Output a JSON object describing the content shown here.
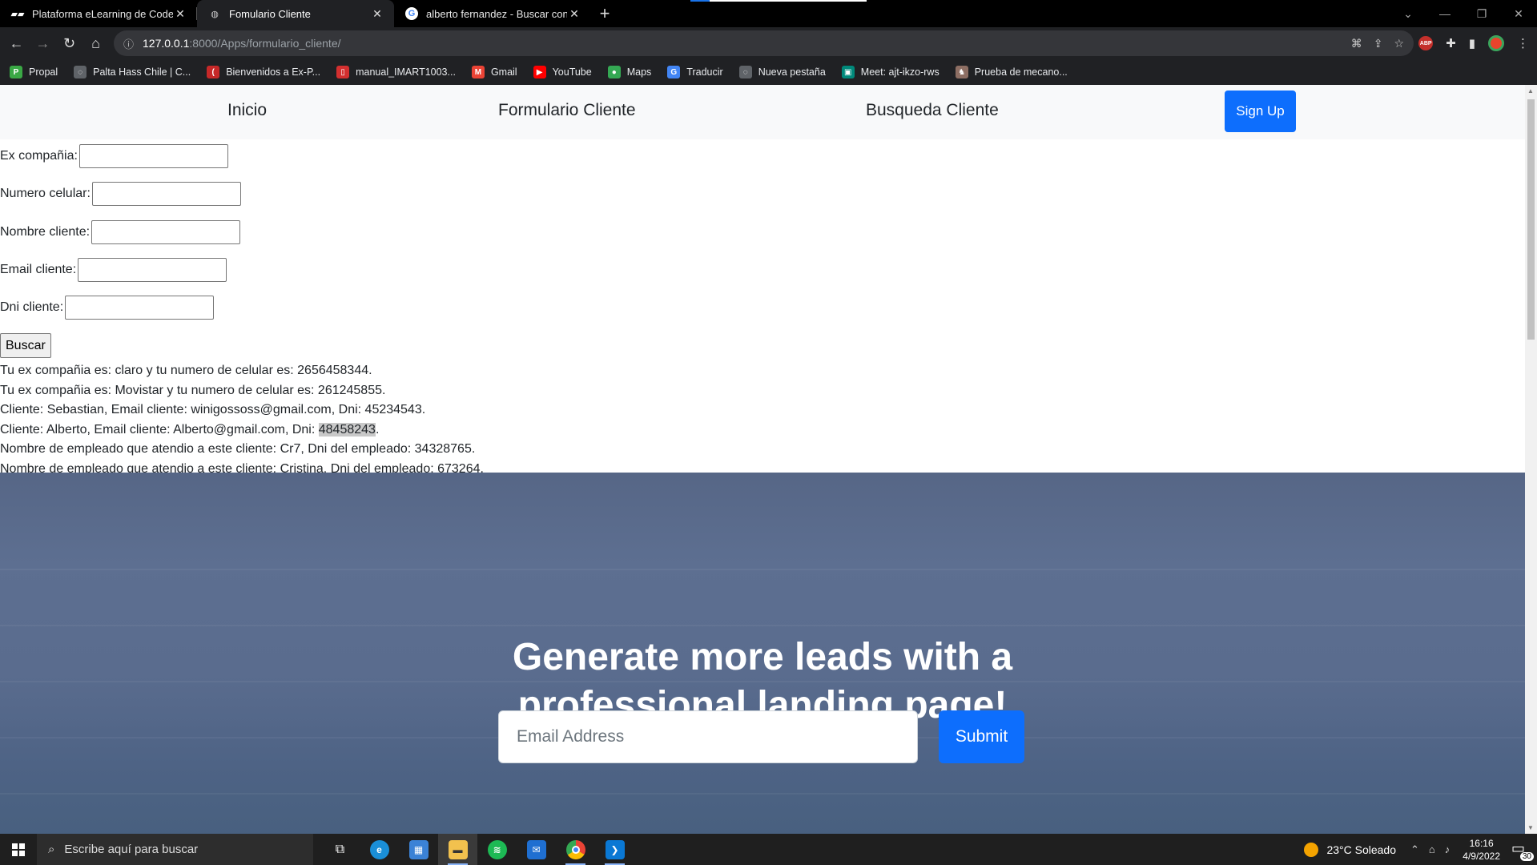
{
  "browser": {
    "tabs": [
      {
        "title": "Plataforma eLearning de Coderhouse",
        "favicon": "coderhouse-icon"
      },
      {
        "title": "Fomulario Cliente",
        "favicon": "globe-icon"
      },
      {
        "title": "alberto fernandez - Buscar con Google",
        "favicon": "google-icon"
      }
    ],
    "active_tab": 1,
    "url_host": "127.0.0.1",
    "url_path": ":8000/Apps/formulario_cliente/",
    "bookmarks": [
      {
        "label": "Propal",
        "color": "#3aa845",
        "glyph": "P"
      },
      {
        "label": "Palta Hass Chile | C...",
        "color": "#5f6368",
        "glyph": "◌"
      },
      {
        "label": "Bienvenidos a Ex-P...",
        "color": "#c62828",
        "glyph": "("
      },
      {
        "label": "manual_IMART1003...",
        "color": "#d32f2f",
        "glyph": "▯"
      },
      {
        "label": "Gmail",
        "color": "#ea4335",
        "glyph": "M"
      },
      {
        "label": "YouTube",
        "color": "#ff0000",
        "glyph": "▶"
      },
      {
        "label": "Maps",
        "color": "#34a853",
        "glyph": "●"
      },
      {
        "label": "Traducir",
        "color": "#4285f4",
        "glyph": "G"
      },
      {
        "label": "Nueva pestaña",
        "color": "#5f6368",
        "glyph": "◌"
      },
      {
        "label": "Meet: ajt-ikzo-rws",
        "color": "#00897b",
        "glyph": "▣"
      },
      {
        "label": "Prueba de mecano...",
        "color": "#8d6e63",
        "glyph": "♞"
      }
    ]
  },
  "site": {
    "nav": {
      "home": "Inicio",
      "form": "Formulario Cliente",
      "search": "Busqueda Cliente",
      "signup": "Sign Up"
    },
    "form": {
      "fields": [
        {
          "label": "Ex compañia:",
          "value": ""
        },
        {
          "label": "Numero celular:",
          "value": ""
        },
        {
          "label": "Nombre cliente:",
          "value": ""
        },
        {
          "label": "Email cliente:",
          "value": ""
        },
        {
          "label": "Dni cliente:",
          "value": ""
        }
      ],
      "button": "Buscar"
    },
    "results": [
      "Tu ex compañia es: claro y tu numero de celular es: 2656458344.",
      "Tu ex compañia es: Movistar y tu numero de celular es: 261245855.",
      "Cliente: Sebastian, Email cliente: winigossoss@gmail.com, Dni: 45234543.",
      {
        "before": "Cliente: Alberto, Email cliente: Alberto@gmail.com, Dni: ",
        "highlight": "48458243",
        "after": "."
      },
      "Nombre de empleado que atendio a este cliente: Cr7, Dni del empleado: 34328765.",
      "Nombre de empleado que atendio a este cliente: Cristina, Dni del empleado: 673264."
    ],
    "masthead": {
      "headline_line1": "Generate more leads with a",
      "headline_line2": "professional landing page!",
      "email_placeholder": "Email Address",
      "submit": "Submit"
    }
  },
  "taskbar": {
    "search_placeholder": "Escribe aquí para buscar",
    "weather": "23°C  Soleado",
    "time": "16:16",
    "date": "4/9/2022",
    "notifications": "30"
  },
  "colors": {
    "primary": "#0d6efd",
    "masthead": "#5a6c8e"
  }
}
